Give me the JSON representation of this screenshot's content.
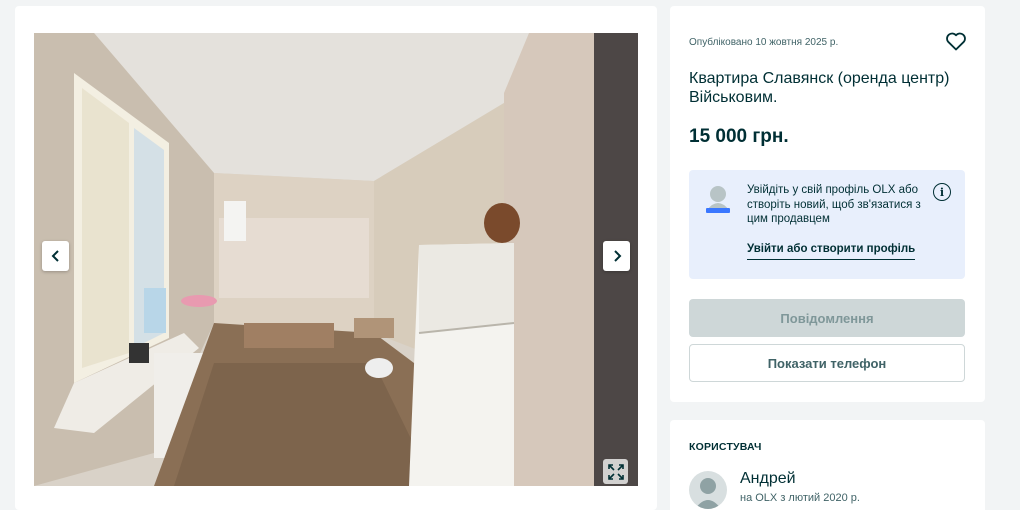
{
  "listing": {
    "published": "Опубліковано 10 жовтня 2025 р.",
    "title": "Квартира Славянск (оренда центр) Військовим.",
    "price": "15 000 грн."
  },
  "login_prompt": {
    "text": "Увійдіть у свій профіль OLX або створіть новий, щоб зв'язатися з цим продавцем",
    "link": "Увійти або створити профіль"
  },
  "actions": {
    "message": "Повідомлення",
    "show_phone": "Показати телефон"
  },
  "user": {
    "heading": "КОРИСТУВАЧ",
    "name": "Андрей",
    "since": "на OLX з лютий 2020 р."
  },
  "icons": {
    "favorite": "heart-icon",
    "info": "info-icon",
    "prev": "chevron-left-icon",
    "next": "chevron-right-icon",
    "fullscreen": "expand-icon"
  },
  "colors": {
    "page_bg": "#f2f4f5",
    "text": "#002f34",
    "login_box_bg": "#e8effc",
    "disabled_button": "#ced7d8"
  }
}
